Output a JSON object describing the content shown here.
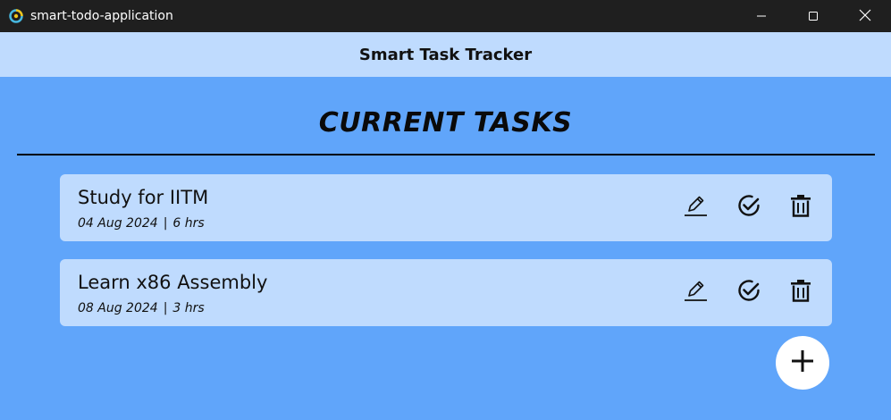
{
  "window": {
    "title": "smart-todo-application",
    "icons": {
      "app": "app-logo-icon",
      "minimize": "minimize-icon",
      "maximize": "maximize-icon",
      "close": "close-icon"
    }
  },
  "appbar": {
    "title": "Smart Task Tracker"
  },
  "main": {
    "heading": "CURRENT TASKS",
    "tasks": [
      {
        "title": "Study for IITM",
        "date": "04 Aug 2024",
        "separator": "|",
        "duration": "6 hrs"
      },
      {
        "title": "Learn x86 Assembly",
        "date": "08 Aug 2024",
        "separator": "|",
        "duration": "3 hrs"
      }
    ],
    "actions": {
      "edit": "pencil-icon",
      "done": "check-circle-icon",
      "delete": "trash-icon"
    },
    "fab": "plus-icon"
  },
  "colors": {
    "background": "#60a5fa",
    "appbar": "#bfdbfe",
    "card": "#bfdbfe",
    "titlebar": "#1f1f1f",
    "fab": "#ffffff"
  }
}
